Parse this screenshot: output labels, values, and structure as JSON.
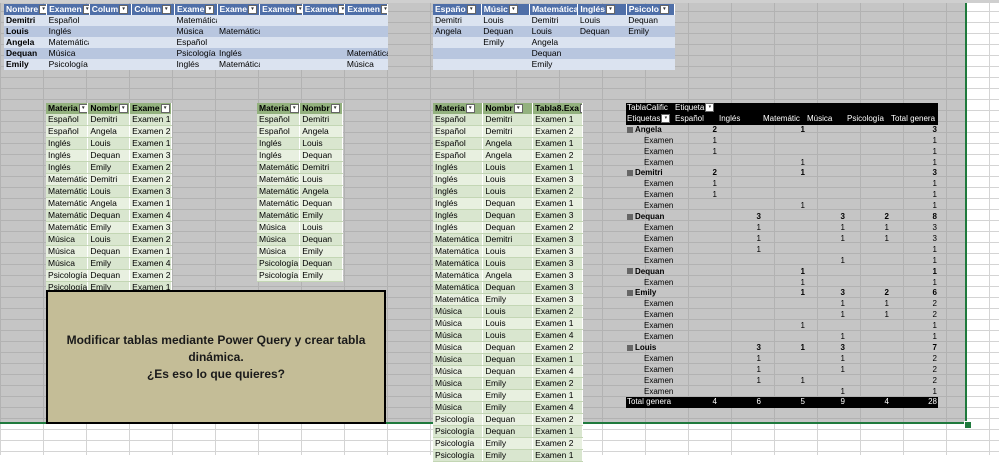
{
  "table_top_left": {
    "headers": [
      "Nombre",
      "Examen",
      "Colum",
      "Colum",
      "Exame",
      "Exame",
      "Examen",
      "Examen",
      "Examen"
    ],
    "rows": [
      [
        "Demitri",
        "Español",
        "",
        "",
        "Matemática",
        "",
        "",
        "",
        ""
      ],
      [
        "Louis",
        "Inglés",
        "",
        "",
        "Música",
        "Matemática",
        "",
        "",
        ""
      ],
      [
        "Angela",
        "Matemática",
        "",
        "",
        "Español",
        "",
        "",
        "",
        ""
      ],
      [
        "Dequan",
        "Música",
        "",
        "",
        "Psicología",
        "Inglés",
        "",
        "",
        "Matemática"
      ],
      [
        "Emily",
        "Psicología",
        "",
        "",
        "Inglés",
        "Matemática",
        "",
        "",
        "Música"
      ]
    ]
  },
  "table_top_right": {
    "headers": [
      "Españo",
      "Músic",
      "Matemática",
      "Inglés",
      "Psicolo"
    ],
    "rows": [
      [
        "Demitri",
        "Louis",
        "Demitri",
        "Louis",
        "Dequan"
      ],
      [
        "Angela",
        "Dequan",
        "Louis",
        "Dequan",
        "Emily"
      ],
      [
        "",
        "Emily",
        "Angela",
        "",
        ""
      ],
      [
        "",
        "",
        "Dequan",
        "",
        ""
      ],
      [
        "",
        "",
        "Emily",
        "",
        ""
      ]
    ]
  },
  "table_green_1": {
    "headers": [
      "Materia",
      "Nombr",
      "Exame"
    ],
    "rows": [
      [
        "Español",
        "Demitri",
        "Examen 1"
      ],
      [
        "Español",
        "Angela",
        "Examen 2"
      ],
      [
        "Inglés",
        "Louis",
        "Examen 1"
      ],
      [
        "Inglés",
        "Dequan",
        "Examen 3"
      ],
      [
        "Inglés",
        "Emily",
        "Examen 2"
      ],
      [
        "Matemática",
        "Demitri",
        "Examen 2"
      ],
      [
        "Matemática",
        "Louis",
        "Examen 3"
      ],
      [
        "Matemática",
        "Angela",
        "Examen 1"
      ],
      [
        "Matemática",
        "Dequan",
        "Examen 4"
      ],
      [
        "Matemática",
        "Emily",
        "Examen 3"
      ],
      [
        "Música",
        "Louis",
        "Examen 2"
      ],
      [
        "Música",
        "Dequan",
        "Examen 1"
      ],
      [
        "Música",
        "Emily",
        "Examen 4"
      ],
      [
        "Psicología",
        "Dequan",
        "Examen 2"
      ],
      [
        "Psicología",
        "Emily",
        "Examen 1"
      ]
    ]
  },
  "table_green_2": {
    "headers": [
      "Materia",
      "Nombr"
    ],
    "rows": [
      [
        "Español",
        "Demitri"
      ],
      [
        "Español",
        "Angela"
      ],
      [
        "Inglés",
        "Louis"
      ],
      [
        "Inglés",
        "Dequan"
      ],
      [
        "Matemática",
        "Demitri"
      ],
      [
        "Matemática",
        "Louis"
      ],
      [
        "Matemática",
        "Angela"
      ],
      [
        "Matemática",
        "Dequan"
      ],
      [
        "Matemática",
        "Emily"
      ],
      [
        "Música",
        "Louis"
      ],
      [
        "Música",
        "Dequan"
      ],
      [
        "Música",
        "Emily"
      ],
      [
        "Psicología",
        "Dequan"
      ],
      [
        "Psicología",
        "Emily"
      ]
    ]
  },
  "table_green_3": {
    "headers": [
      "Materia",
      "Nombr",
      "Tabla8.Exa"
    ],
    "rows": [
      [
        "Español",
        "Demitri",
        "Examen 1"
      ],
      [
        "Español",
        "Demitri",
        "Examen 2"
      ],
      [
        "Español",
        "Angela",
        "Examen 1"
      ],
      [
        "Español",
        "Angela",
        "Examen 2"
      ],
      [
        "Inglés",
        "Louis",
        "Examen 1"
      ],
      [
        "Inglés",
        "Louis",
        "Examen 3"
      ],
      [
        "Inglés",
        "Louis",
        "Examen 2"
      ],
      [
        "Inglés",
        "Dequan",
        "Examen 1"
      ],
      [
        "Inglés",
        "Dequan",
        "Examen 3"
      ],
      [
        "Inglés",
        "Dequan",
        "Examen 2"
      ],
      [
        "Matemática",
        "Demitri",
        "Examen 3"
      ],
      [
        "Matemática",
        "Louis",
        "Examen 3"
      ],
      [
        "Matemática",
        "Louis",
        "Examen 3"
      ],
      [
        "Matemática",
        "Angela",
        "Examen 3"
      ],
      [
        "Matemática",
        "Dequan",
        "Examen 3"
      ],
      [
        "Matemática",
        "Emily",
        "Examen 3"
      ],
      [
        "Música",
        "Louis",
        "Examen 2"
      ],
      [
        "Música",
        "Louis",
        "Examen 1"
      ],
      [
        "Música",
        "Louis",
        "Examen 4"
      ],
      [
        "Música",
        "Dequan",
        "Examen 2"
      ],
      [
        "Música",
        "Dequan",
        "Examen 1"
      ],
      [
        "Música",
        "Dequan",
        "Examen 4"
      ],
      [
        "Música",
        "Emily",
        "Examen 2"
      ],
      [
        "Música",
        "Emily",
        "Examen 1"
      ],
      [
        "Música",
        "Emily",
        "Examen 4"
      ],
      [
        "Psicología",
        "Dequan",
        "Examen 2"
      ],
      [
        "Psicología",
        "Dequan",
        "Examen 1"
      ],
      [
        "Psicología",
        "Emily",
        "Examen 2"
      ],
      [
        "Psicología",
        "Emily",
        "Examen 1"
      ]
    ]
  },
  "note": {
    "text": "Modificar tablas mediante Power Query y crear tabla\ndinámica.\n¿Es eso lo que quieres?"
  },
  "pivot": {
    "title": "TablaCalific",
    "col_label": "Etiqueta",
    "row_label": "Etiquetas",
    "columns": [
      "Español",
      "Inglés",
      "Matemátic",
      "Música",
      "Psicología",
      "Total genera"
    ],
    "rows": [
      {
        "label": "Angela",
        "group": true,
        "vals": [
          "2",
          "",
          "1",
          "",
          "",
          "3"
        ]
      },
      {
        "label": "Examen",
        "group": false,
        "vals": [
          "1",
          "",
          "",
          "",
          "",
          "1"
        ]
      },
      {
        "label": "Examen",
        "group": false,
        "vals": [
          "1",
          "",
          "",
          "",
          "",
          "1"
        ]
      },
      {
        "label": "Examen 3",
        "group": false,
        "vals": [
          "",
          "",
          "1",
          "",
          "",
          "1"
        ]
      },
      {
        "label": "Demitri",
        "group": true,
        "vals": [
          "2",
          "",
          "1",
          "",
          "",
          "3"
        ]
      },
      {
        "label": "Examen",
        "group": false,
        "vals": [
          "1",
          "",
          "",
          "",
          "",
          "1"
        ]
      },
      {
        "label": "Examen",
        "group": false,
        "vals": [
          "1",
          "",
          "",
          "",
          "",
          "1"
        ]
      },
      {
        "label": "Examen 3",
        "group": false,
        "vals": [
          "",
          "",
          "1",
          "",
          "",
          "1"
        ]
      },
      {
        "label": "Dequan",
        "group": true,
        "vals": [
          "",
          "3",
          "",
          "3",
          "2",
          "8"
        ]
      },
      {
        "label": "Examen 1",
        "group": false,
        "vals": [
          "",
          "1",
          "",
          "1",
          "1",
          "3"
        ]
      },
      {
        "label": "Examen 2",
        "group": false,
        "vals": [
          "",
          "1",
          "",
          "1",
          "1",
          "3"
        ]
      },
      {
        "label": "Examen 3",
        "group": false,
        "vals": [
          "",
          "1",
          "",
          "",
          "",
          "1"
        ]
      },
      {
        "label": "Examen 4",
        "group": false,
        "vals": [
          "",
          "",
          "",
          "1",
          "",
          "1"
        ]
      },
      {
        "label": "Dequan",
        "group": true,
        "vals": [
          "",
          "",
          "1",
          "",
          "",
          "1"
        ]
      },
      {
        "label": "Examen 3",
        "group": false,
        "vals": [
          "",
          "",
          "1",
          "",
          "",
          "1"
        ]
      },
      {
        "label": "Emily",
        "group": true,
        "vals": [
          "",
          "",
          "1",
          "3",
          "2",
          "6"
        ]
      },
      {
        "label": "Examen 1",
        "group": false,
        "vals": [
          "",
          "",
          "",
          "1",
          "1",
          "2"
        ]
      },
      {
        "label": "Examen 2",
        "group": false,
        "vals": [
          "",
          "",
          "",
          "1",
          "1",
          "2"
        ]
      },
      {
        "label": "Examen 3",
        "group": false,
        "vals": [
          "",
          "",
          "1",
          "",
          "",
          "1"
        ]
      },
      {
        "label": "Examen 4",
        "group": false,
        "vals": [
          "",
          "",
          "",
          "1",
          "",
          "1"
        ]
      },
      {
        "label": "Louis",
        "group": true,
        "vals": [
          "",
          "3",
          "1",
          "3",
          "",
          "7"
        ]
      },
      {
        "label": "Examen 1",
        "group": false,
        "vals": [
          "",
          "1",
          "",
          "1",
          "",
          "2"
        ]
      },
      {
        "label": "Examen 2",
        "group": false,
        "vals": [
          "",
          "1",
          "",
          "1",
          "",
          "2"
        ]
      },
      {
        "label": "Examen 3",
        "group": false,
        "vals": [
          "",
          "1",
          "1",
          "",
          "",
          "2"
        ]
      },
      {
        "label": "Examen 4",
        "group": false,
        "vals": [
          "",
          "",
          "",
          "1",
          "",
          "1"
        ]
      }
    ],
    "total": {
      "label": "Total genera",
      "vals": [
        "4",
        "6",
        "5",
        "9",
        "4",
        "28"
      ]
    }
  }
}
